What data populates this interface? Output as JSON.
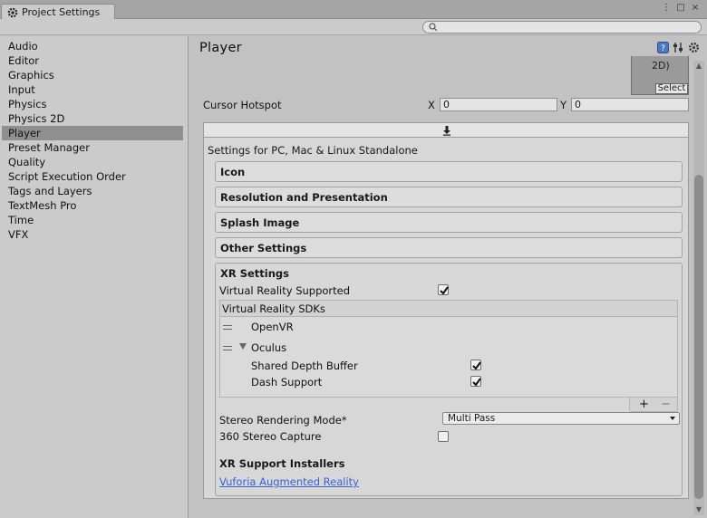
{
  "window": {
    "tab_title": "Project Settings",
    "controls": [
      "⋮",
      "□",
      "×"
    ]
  },
  "search": {
    "placeholder": "",
    "value": ""
  },
  "sidebar": {
    "items": [
      {
        "label": "Audio"
      },
      {
        "label": "Editor"
      },
      {
        "label": "Graphics"
      },
      {
        "label": "Input"
      },
      {
        "label": "Physics"
      },
      {
        "label": "Physics 2D"
      },
      {
        "label": "Player",
        "selected": true
      },
      {
        "label": "Preset Manager"
      },
      {
        "label": "Quality"
      },
      {
        "label": "Script Execution Order"
      },
      {
        "label": "Tags and Layers"
      },
      {
        "label": "TextMesh Pro"
      },
      {
        "label": "Time"
      },
      {
        "label": "VFX"
      }
    ]
  },
  "main": {
    "title": "Player",
    "cursor_preview_text": "2D)",
    "cursor_select_label": "Select",
    "cursor_hotspot": {
      "label": "Cursor Hotspot",
      "x_label": "X",
      "x_value": "0",
      "y_label": "Y",
      "y_value": "0"
    },
    "platform_caption": "Settings for PC, Mac & Linux Standalone",
    "sections": [
      {
        "title": "Icon"
      },
      {
        "title": "Resolution and Presentation"
      },
      {
        "title": "Splash Image"
      },
      {
        "title": "Other Settings"
      }
    ],
    "xr": {
      "title": "XR Settings",
      "vr_supported_label": "Virtual Reality Supported",
      "vr_supported": true,
      "sdk_list_header": "Virtual Reality SDKs",
      "sdks": [
        {
          "name": "OpenVR",
          "expanded": false
        },
        {
          "name": "Oculus",
          "expanded": true
        }
      ],
      "oculus_options": [
        {
          "label": "Shared Depth Buffer",
          "checked": true
        },
        {
          "label": "Dash Support",
          "checked": true
        }
      ],
      "list_add": "+",
      "list_remove": "−",
      "stereo_mode_label": "Stereo Rendering Mode*",
      "stereo_mode_value": "Multi Pass",
      "stereo_capture_label": "360 Stereo Capture",
      "stereo_capture": false,
      "installers_title": "XR Support Installers",
      "installer_link": "Vuforia Augmented Reality"
    }
  },
  "colors": {
    "selected_row": "#8f8f8f",
    "link": "#3a62d4",
    "panel_bg": "#d7d7d7"
  }
}
